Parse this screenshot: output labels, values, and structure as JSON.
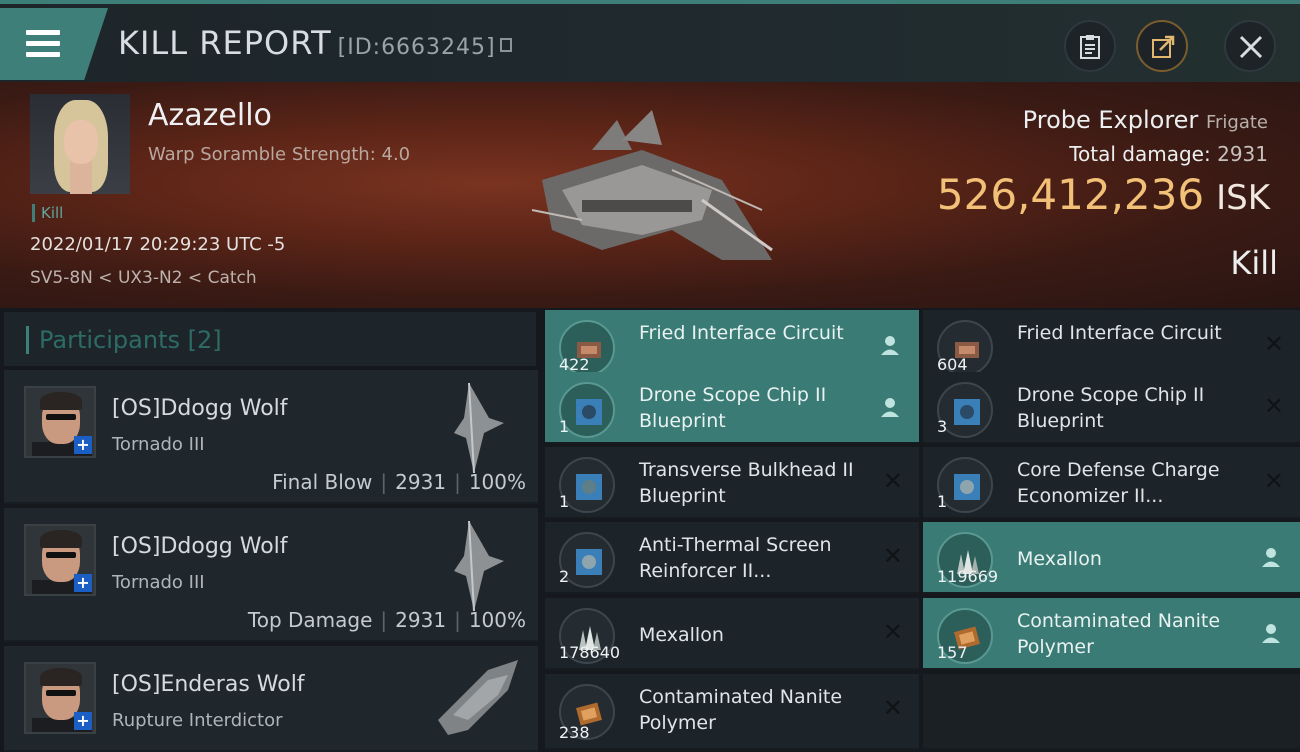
{
  "header": {
    "title": "KILL REPORT",
    "id_label": "[ID:6663245]"
  },
  "victim": {
    "name": "Azazello",
    "warp_strength": "Warp Soramble Strength: 4.0",
    "kill_tag": "Kill",
    "datetime": "2022/01/17 20:29:23 UTC -5",
    "location": "SV5-8N < UX3-N2 < Catch",
    "ship": "Probe Explorer",
    "ship_class": "Frigate",
    "total_damage_label": "Total damage:",
    "total_damage": "2931",
    "isk_value": "526,412,236",
    "isk_unit": "ISK",
    "result": "Kill"
  },
  "participants": {
    "label": "Participants",
    "count": "[2]",
    "rows": [
      {
        "name": "[OS]Ddogg Wolf",
        "ship": "Tornado III",
        "tag": "Final Blow",
        "damage": "2931",
        "percent": "100%"
      },
      {
        "name": "[OS]Ddogg Wolf",
        "ship": "Tornado III",
        "tag": "Top Damage",
        "damage": "2931",
        "percent": "100%"
      },
      {
        "name": "[OS]Enderas Wolf",
        "ship": "Rupture Interdictor"
      }
    ]
  },
  "items_left": [
    {
      "qty": "422",
      "name": "Fried Interface Circuit",
      "state": "dropped"
    },
    {
      "qty": "1",
      "name": "Drone Scope Chip II Blueprint",
      "state": "dropped"
    },
    {
      "qty": "1",
      "name": "Transverse Bulkhead II Blueprint",
      "state": "destroyed"
    },
    {
      "qty": "2",
      "name": "Anti-Thermal Screen Reinforcer II...",
      "state": "destroyed"
    },
    {
      "qty": "178640",
      "name": "Mexallon",
      "state": "destroyed"
    },
    {
      "qty": "238",
      "name": "Contaminated Nanite Polymer",
      "state": "destroyed"
    }
  ],
  "items_right": [
    {
      "qty": "604",
      "name": "Fried Interface Circuit",
      "state": "destroyed"
    },
    {
      "qty": "3",
      "name": "Drone Scope Chip II Blueprint",
      "state": "destroyed"
    },
    {
      "qty": "1",
      "name": "Core Defense Charge Economizer II...",
      "state": "destroyed"
    },
    {
      "qty": "119669",
      "name": "Mexallon",
      "state": "dropped"
    },
    {
      "qty": "157",
      "name": "Contaminated Nanite Polymer",
      "state": "dropped"
    }
  ],
  "icons": {
    "menu": "hamburger-menu-icon",
    "copy": "copy-icon",
    "clipboard": "clipboard-icon",
    "share": "share-icon",
    "close": "close-icon",
    "person": "person-icon",
    "destroyed": "x-icon"
  },
  "colors": {
    "accent": "#3f7f79",
    "isk": "#f2c077",
    "dropped_row": "#3b7b75"
  }
}
